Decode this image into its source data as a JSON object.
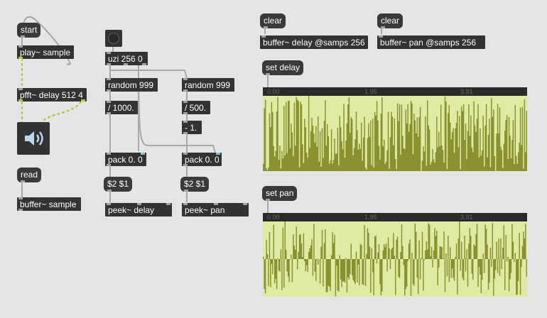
{
  "colors": {
    "background": "#e5e5e5",
    "object": "#333333",
    "waveform_fill": "#dfeaa3",
    "waveform_stroke": "#8a9130",
    "signal_cable": "#b6c43a",
    "cable": "#a9a9a9"
  },
  "objects": {
    "start": "start",
    "play_sample": "play~ sample",
    "pfft_delay": "pfft~ delay 512 4",
    "read": "read",
    "buffer_sample": "buffer~ sample",
    "uzi": "uzi 256 0",
    "random_left": "random 999",
    "random_right": "random 999",
    "div_1000": "/ 1000.",
    "div_500": "/ 500.",
    "minus_1": "- 1.",
    "pack_left": "pack 0. 0",
    "pack_right": "pack 0. 0",
    "msg_left": "$2 $1",
    "msg_right": "$2 $1",
    "peek_delay": "peek~ delay",
    "peek_pan": "peek~ pan",
    "clear_delay": "clear",
    "clear_pan": "clear",
    "buffer_delay": "buffer~ delay @samps 256",
    "buffer_pan": "buffer~ pan @samps 256",
    "set_delay": "set delay",
    "set_pan": "set pan"
  },
  "icons": {
    "bang": "bang-button-icon",
    "speaker": "speaker-icon"
  },
  "waveforms": {
    "delay": {
      "ruler_labels": [
        "0.00",
        "1.95",
        "3.91"
      ],
      "samples": 256,
      "range": [
        0,
        1
      ]
    },
    "pan": {
      "ruler_labels": [
        "0.00",
        "1.95",
        "3.91"
      ],
      "samples": 256,
      "range": [
        -1,
        1
      ]
    }
  }
}
